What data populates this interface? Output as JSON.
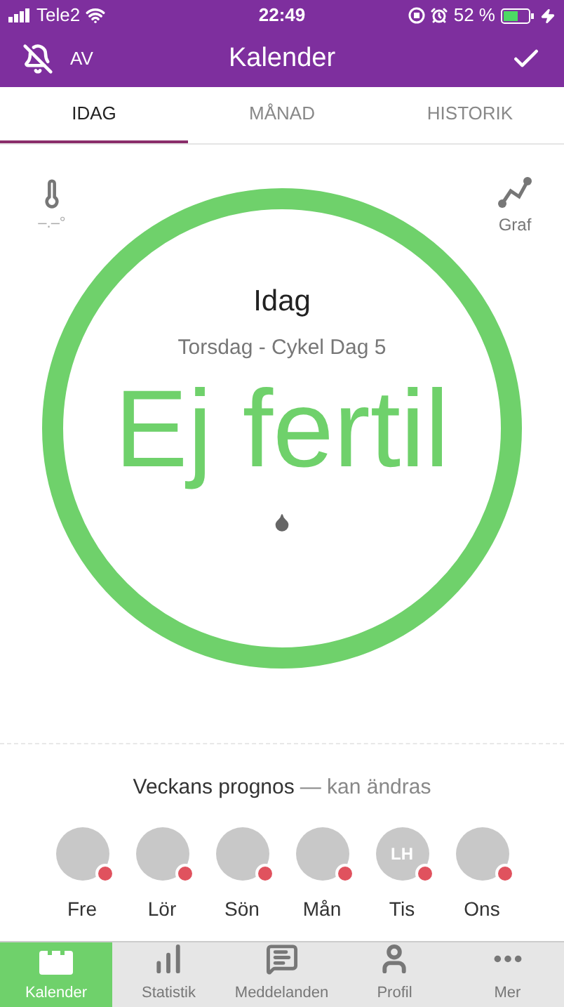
{
  "status_bar": {
    "carrier": "Tele2",
    "time": "22:49",
    "battery": "52 %"
  },
  "header": {
    "alarm_label": "AV",
    "title": "Kalender"
  },
  "tabs": [
    {
      "label": "IDAG",
      "selected": true
    },
    {
      "label": "MÅNAD",
      "selected": false
    },
    {
      "label": "HISTORIK",
      "selected": false
    }
  ],
  "today": {
    "temperature": "–.–°",
    "graph_label": "Graf",
    "heading": "Idag",
    "subtitle": "Torsdag - Cykel Dag 5",
    "status": "Ej fertil"
  },
  "forecast": {
    "title": "Veckans prognos",
    "note": "— kan ändras",
    "days": [
      {
        "label": "Fre"
      },
      {
        "label": "Lör"
      },
      {
        "label": "Sön"
      },
      {
        "label": "Mån"
      },
      {
        "label": "Tis",
        "badge": "LH"
      },
      {
        "label": "Ons"
      }
    ]
  },
  "nav": [
    {
      "label": "Kalender",
      "kind": "calendar",
      "selected": true
    },
    {
      "label": "Statistik",
      "kind": "stats",
      "selected": false
    },
    {
      "label": "Meddelanden",
      "kind": "messages",
      "selected": false
    },
    {
      "label": "Profil",
      "kind": "profile",
      "selected": false
    },
    {
      "label": "Mer",
      "kind": "more",
      "selected": false
    }
  ]
}
